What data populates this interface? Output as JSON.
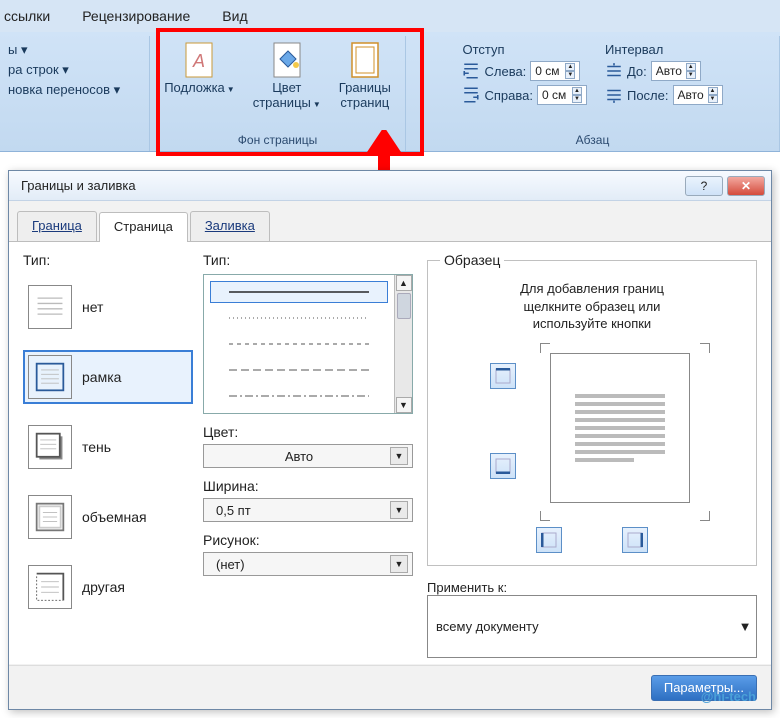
{
  "menubar": {
    "items": [
      "ссылки",
      "Рецензирование",
      "Вид"
    ]
  },
  "ribbon": {
    "group_left": {
      "rows": [
        "ы ▾",
        "ра строк ▾",
        "новка переносов ▾"
      ]
    },
    "page_bg": {
      "label": "Фон страницы",
      "watermark": "Подложка",
      "page_color": "Цвет\nстраницы",
      "borders": "Границы\nстраниц"
    },
    "paragraph": {
      "label": "Абзац",
      "indent_label": "Отступ",
      "left_label": "Слева:",
      "right_label": "Справа:",
      "left_val": "0 см",
      "right_val": "0 см",
      "spacing_label": "Интервал",
      "before_label": "До:",
      "after_label": "После:",
      "before_val": "Авто",
      "after_val": "Авто"
    }
  },
  "dialog": {
    "title": "Границы и заливка",
    "tabs": {
      "border": "Граница",
      "page": "Страница",
      "fill": "Заливка",
      "active": "page"
    },
    "type_label": "Тип:",
    "types": [
      {
        "key": "none",
        "label": "нет"
      },
      {
        "key": "box",
        "label": "рамка"
      },
      {
        "key": "shadow",
        "label": "тень"
      },
      {
        "key": "threeD",
        "label": "объемная"
      },
      {
        "key": "custom",
        "label": "другая"
      }
    ],
    "selected_type": "box",
    "style_label": "Тип:",
    "color_label": "Цвет:",
    "color_value": "Авто",
    "width_label": "Ширина:",
    "width_value": "0,5 пт",
    "art_label": "Рисунок:",
    "art_value": "(нет)",
    "sample_legend": "Образец",
    "sample_text": "Для добавления границ\nщелкните образец или\nиспользуйте кнопки",
    "apply_label": "Применить к:",
    "apply_value": "всему документу",
    "options_btn": "Параметры..."
  },
  "watermark": "@hi-tech"
}
